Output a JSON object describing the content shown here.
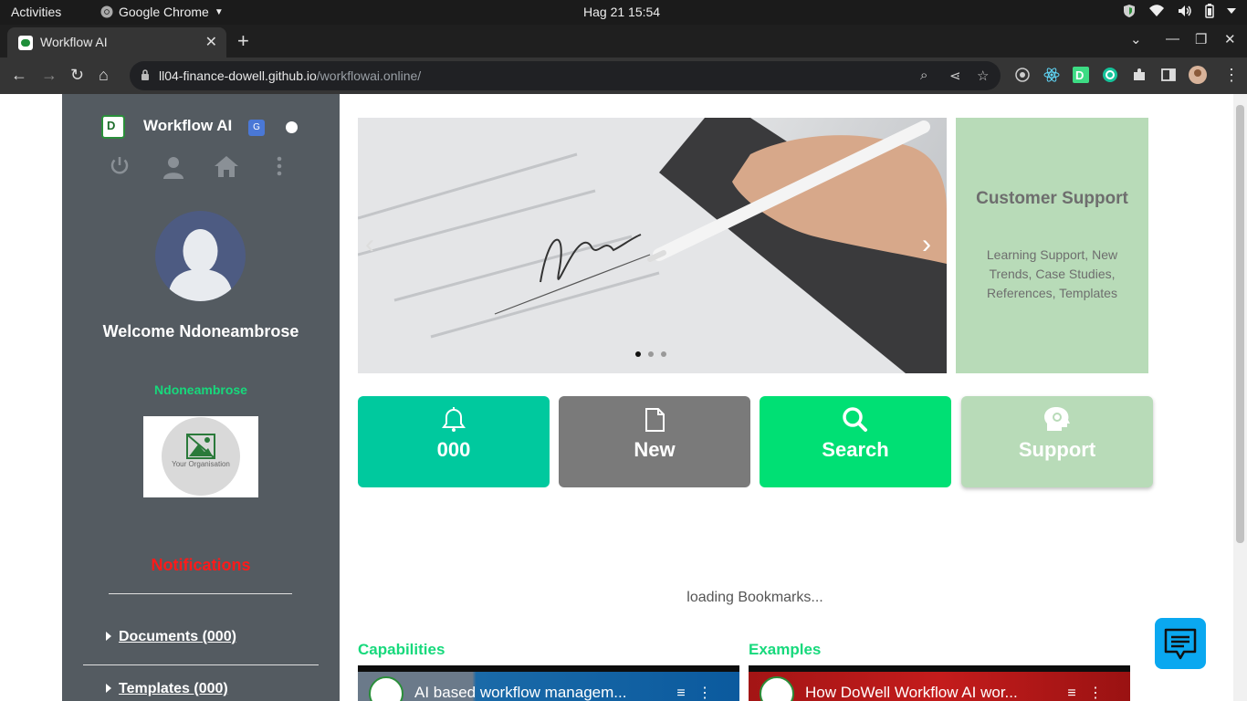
{
  "os_bar": {
    "activities": "Activities",
    "app_name": "Google Chrome",
    "clock": "Hag 21  15:54"
  },
  "browser": {
    "tab_title": "Workflow AI",
    "url_host": "ll04-finance-dowell.github.io",
    "url_path": "/workflowai.online/"
  },
  "sidebar": {
    "app_title": "Workflow AI",
    "welcome": "Welcome Ndoneambrose",
    "username": "Ndoneambrose",
    "org_placeholder": "Your Organisation",
    "notifications_title": "Notifications",
    "links": [
      {
        "label": "Documents (000)"
      },
      {
        "label": "Templates (000)"
      }
    ]
  },
  "carousel": {
    "slide_count": 3,
    "active_index": 0
  },
  "support_card": {
    "title": "Customer Support",
    "description": "Learning Support, New Trends, Case Studies, References, Templates"
  },
  "tiles": [
    {
      "label": "000",
      "icon": "bell-icon",
      "color": "#00c99e"
    },
    {
      "label": "New",
      "icon": "document-icon",
      "color": "#7a7a7a"
    },
    {
      "label": "Search",
      "icon": "search-icon",
      "color": "#00e074"
    },
    {
      "label": "Support",
      "icon": "head-gear-icon",
      "color": "#b8dbb8"
    }
  ],
  "bookmarks_status": "loading Bookmarks...",
  "sections": {
    "capabilities_title": "Capabilities",
    "examples_title": "Examples",
    "capabilities_video_title": "AI based workflow managem...",
    "examples_video_title": "How DoWell Workflow AI wor..."
  },
  "colors": {
    "sidebar_bg": "#545b61",
    "accent_green": "#17d97c",
    "notification_red": "#ff1a1a",
    "chat_button": "#0aa8f0"
  }
}
